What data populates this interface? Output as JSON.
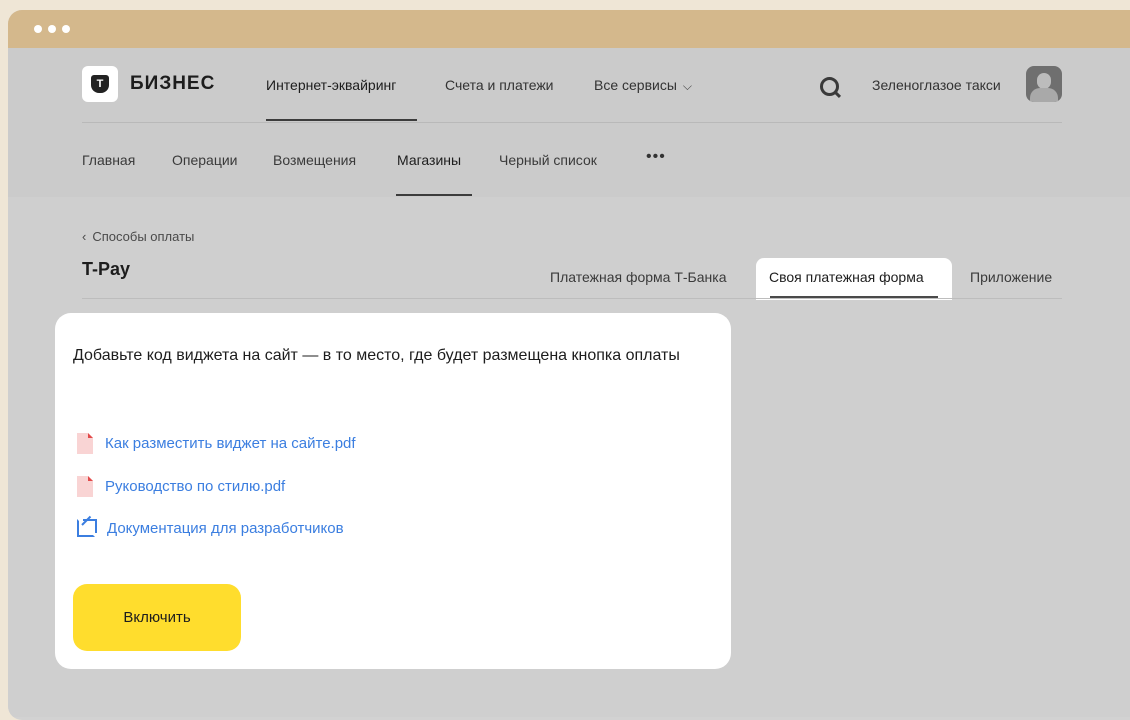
{
  "window": {
    "chrome": "window-dots"
  },
  "header": {
    "logo_text": "БИЗНЕС",
    "logo_letter": "Т",
    "top_nav": [
      {
        "label": "Интернет-эквайринг",
        "active": true
      },
      {
        "label": "Счета и платежи",
        "active": false
      },
      {
        "label": "Все сервисы",
        "active": false
      }
    ],
    "user_name": "Зеленоглазое такси",
    "search_icon": "search-icon",
    "sub_nav": [
      {
        "label": "Главная",
        "active": false
      },
      {
        "label": "Операции",
        "active": false
      },
      {
        "label": "Возмещения",
        "active": false
      },
      {
        "label": "Магазины",
        "active": true
      },
      {
        "label": "Черный список",
        "active": false
      }
    ],
    "more_label": "•••"
  },
  "page": {
    "back_label": "Способы оплаты",
    "title": "T-Pay",
    "tabs": [
      {
        "label": "Платежная форма Т-Банка",
        "active": false
      },
      {
        "label": "Своя платежная форма",
        "active": true
      },
      {
        "label": "Приложение",
        "active": false
      }
    ]
  },
  "card": {
    "title": "Добавьте код виджета на сайт — в то место, где будет размещена кнопка оплаты",
    "links": [
      {
        "label": "Как разместить виджет на сайте.pdf",
        "icon": "pdf-icon"
      },
      {
        "label": "Руководство по стилю.pdf",
        "icon": "pdf-icon"
      },
      {
        "label": "Документация для разработчиков",
        "icon": "external-link-icon"
      }
    ],
    "button_label": "Включить",
    "button_color": "#FFDD2D",
    "link_color": "#3B7EE0"
  }
}
